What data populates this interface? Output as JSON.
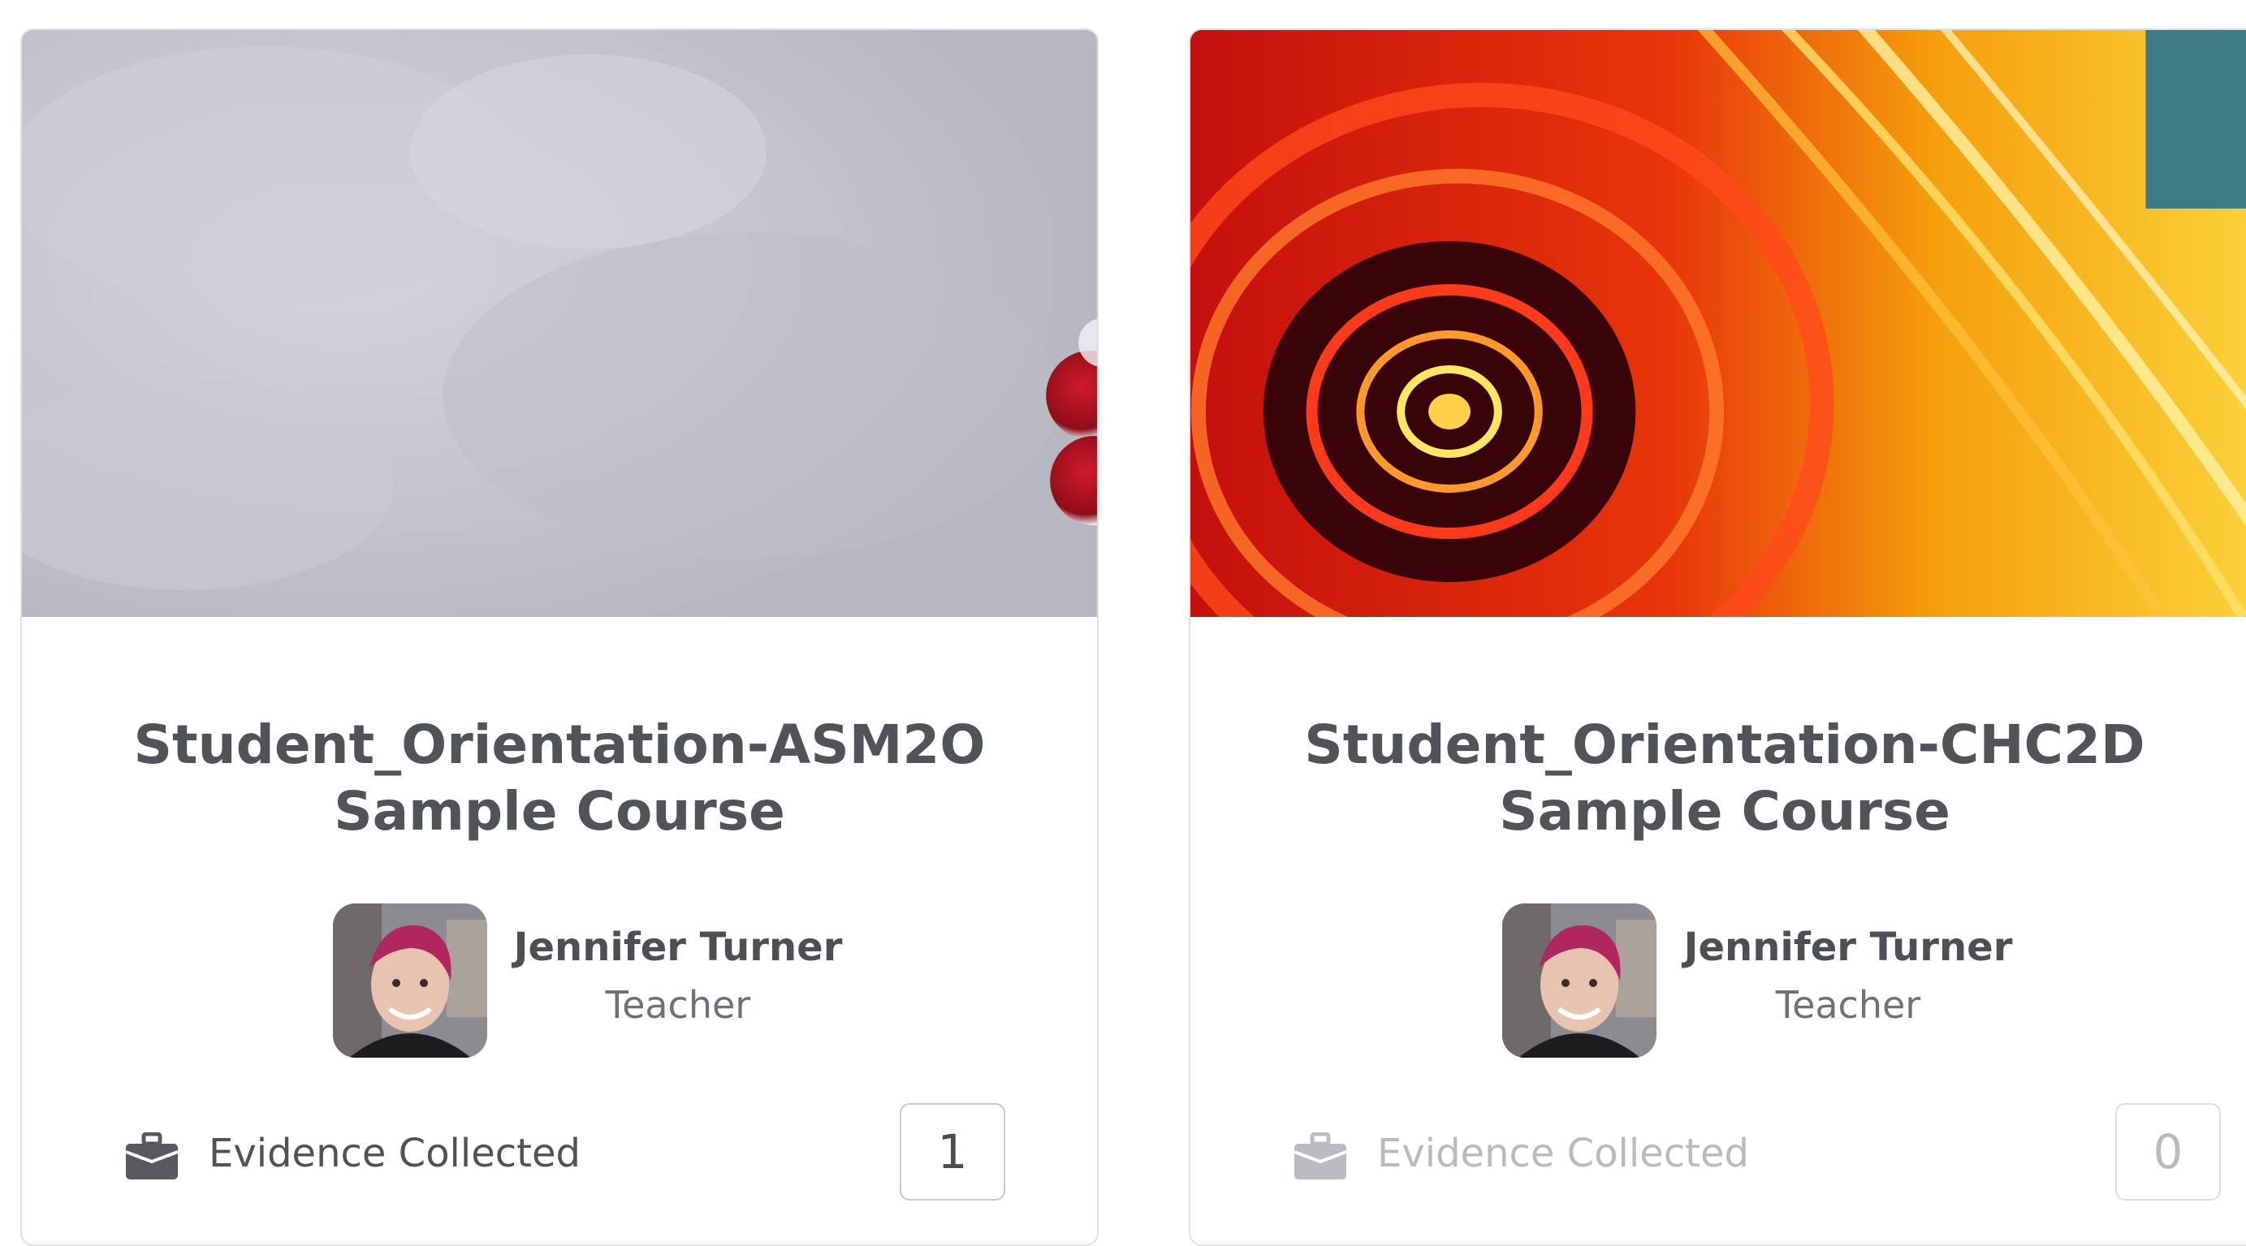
{
  "colors": {
    "card_border": "#dfe1e4",
    "title_text": "#505459",
    "muted_text": "#b7babe"
  },
  "courses": [
    {
      "title_line1": "Student_Orientation-ASM2O",
      "title_line2": "Sample Course",
      "teacher_name": "Jennifer Turner",
      "teacher_role": "Teacher",
      "evidence_icon": "briefcase-icon",
      "evidence_label": "Evidence Collected",
      "evidence_count": "1",
      "dimmed": false
    },
    {
      "title_line1": "Student_Orientation-CHC2D",
      "title_line2": "Sample Course",
      "teacher_name": "Jennifer Turner",
      "teacher_role": "Teacher",
      "evidence_icon": "briefcase-icon",
      "evidence_label": "Evidence Collected",
      "evidence_count": "0",
      "dimmed": true
    }
  ]
}
